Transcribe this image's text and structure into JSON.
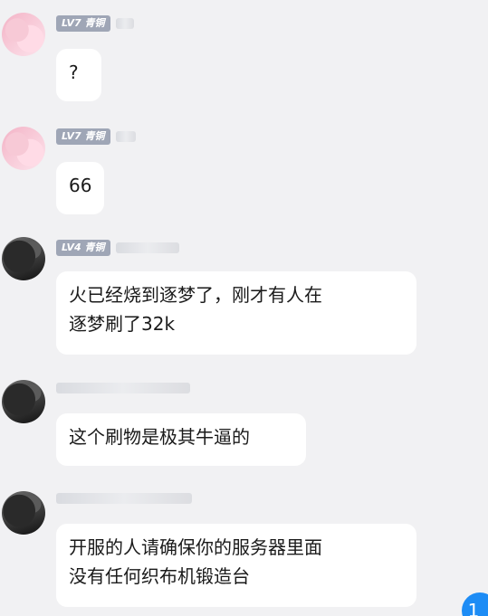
{
  "messages": [
    {
      "avatar": "pink-anime-avatar",
      "level": "LV7 青铜",
      "text": "?"
    },
    {
      "avatar": "pink-anime-avatar",
      "level": "LV7 青铜",
      "text": "66"
    },
    {
      "avatar": "dark-avatar",
      "level": "LV4 青铜",
      "text": "火已经烧到逐梦了，刚才有人在\n逐梦刷了32k"
    },
    {
      "avatar": "dark-avatar",
      "level": "",
      "text": "这个刷物是极其牛逼的"
    },
    {
      "avatar": "dark-avatar",
      "level": "",
      "text": "开服的人请确保你的服务器里面\n没有任何织布机锻造台"
    }
  ],
  "unread_count": "1",
  "colors": {
    "background": "#f1f1f3",
    "bubble": "#ffffff",
    "level_badge": "#9fa6b6",
    "unread_badge": "#1d8cf5"
  }
}
